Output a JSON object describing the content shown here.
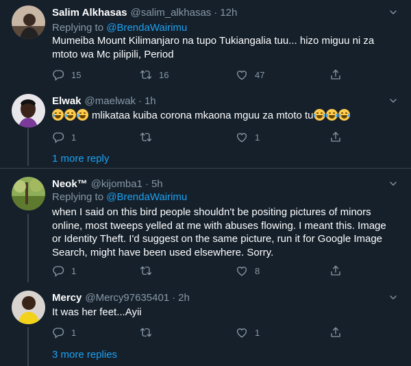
{
  "colors": {
    "background": "#15202b",
    "text": "#ffffff",
    "muted": "#8899a6",
    "link": "#1da1f2",
    "border": "#38444d"
  },
  "tweets": [
    {
      "name": "Salim Alkhasas",
      "handle": "@salim_alkhasas",
      "time": "12h",
      "replying_prefix": "Replying to ",
      "replying_to": "@BrendaWairimu",
      "text": "Mumeiba Mount Kilimanjaro na tupo Tukiangalia tuu... hizo miguu ni za mtoto wa Mc pilipili, Period",
      "replies": "15",
      "retweets": "16",
      "likes": "47"
    },
    {
      "name": "Elwak",
      "handle": "@maelwak",
      "time": "1h",
      "text": "mlikataa kuiba corona mkaona mguu za mtoto tu",
      "replies": "1",
      "retweets": "",
      "likes": "1",
      "more_link": "1 more reply"
    },
    {
      "name": "Neok™",
      "handle": "@kijomba1",
      "time": "5h",
      "replying_prefix": "Replying to ",
      "replying_to": "@BrendaWairimu",
      "text": "when I said on this bird people shouldn't be positing pictures of minors online, most tweeps yelled at me with abuses flowing. I meant this. Image or Identity Theft. I'd suggest on the same picture, run it for Google Image Search, might have been used elsewhere. Sorry.",
      "replies": "1",
      "retweets": "",
      "likes": "8"
    },
    {
      "name": "Mercy",
      "handle": "@Mercy97635401",
      "time": "2h",
      "text": "It was her feet...Ayii",
      "replies": "1",
      "retweets": "",
      "likes": "1",
      "more_link": "3 more replies"
    }
  ],
  "separator": "·",
  "icons": {
    "reply": "reply-icon",
    "retweet": "retweet-icon",
    "like": "heart-icon",
    "share": "share-icon",
    "caret": "chevron-down-icon",
    "emoji_laugh": "rolling-laughing-emoji",
    "emoji_joy": "tears-of-joy-emoji"
  }
}
